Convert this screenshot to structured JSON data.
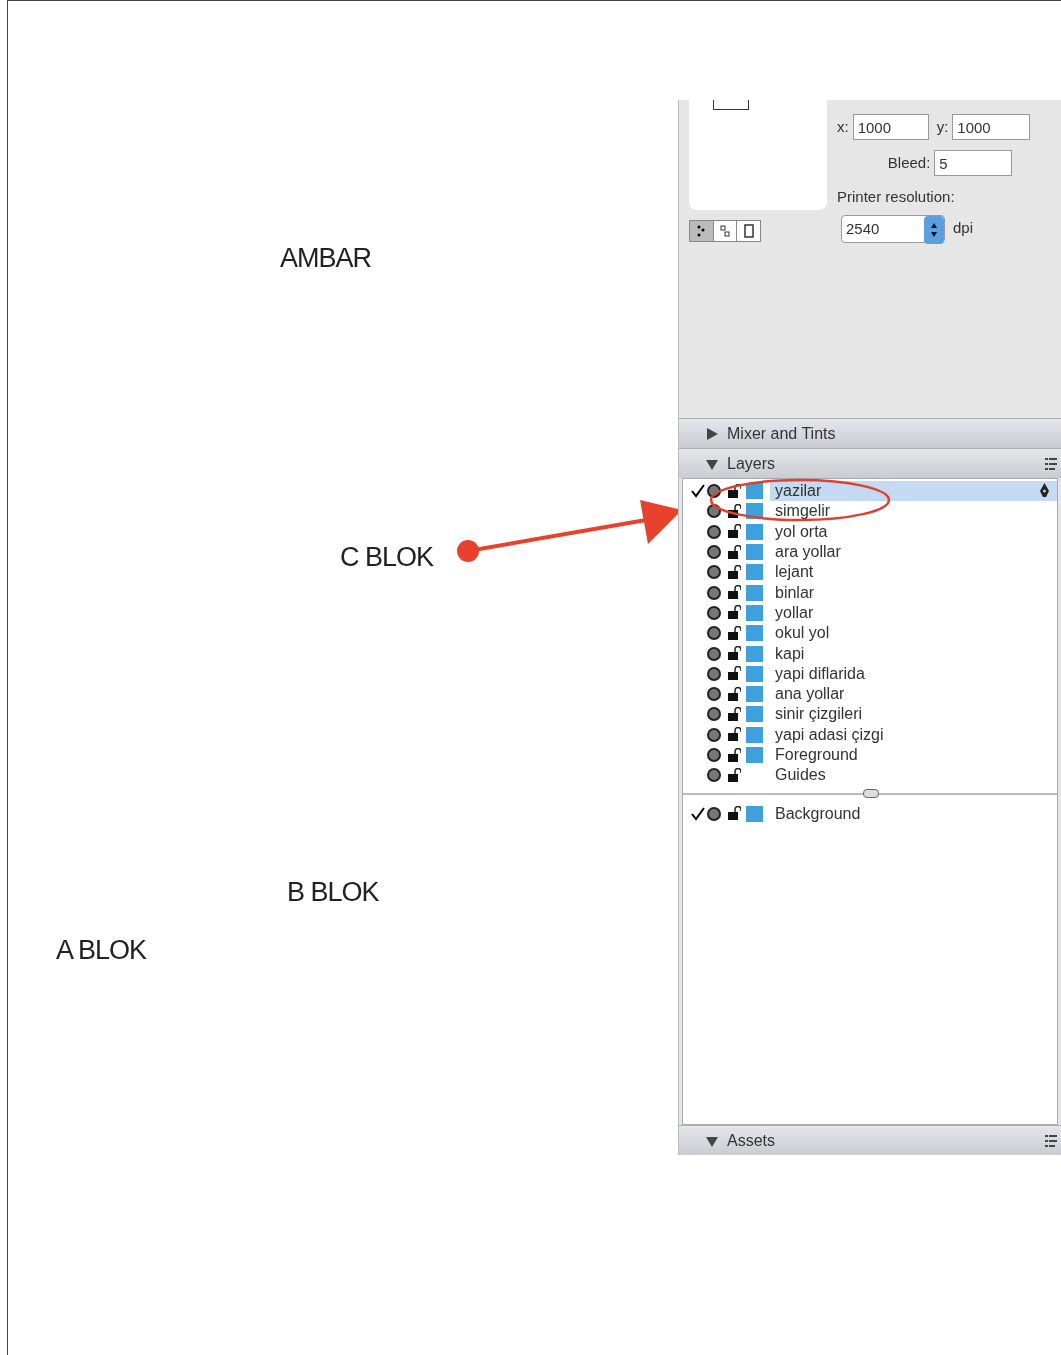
{
  "canvas_labels": [
    {
      "text": "AMBAR",
      "kind": "plain"
    },
    {
      "text": "C BLOK",
      "kind": "pointed"
    },
    {
      "text": "B BLOK",
      "kind": "plain"
    },
    {
      "text": "A BLOK",
      "kind": "plain"
    }
  ],
  "document": {
    "x_label": "x:",
    "x_value": "1000",
    "y_label": "y:",
    "y_value": "1000",
    "bleed_label": "Bleed:",
    "bleed_value": "5",
    "resolution_label": "Printer resolution:",
    "resolution_value": "2540",
    "resolution_unit": "dpi"
  },
  "mixer": {
    "title": "Mixer and Tints",
    "expanded": false
  },
  "layers": {
    "title": "Layers",
    "expanded": true,
    "items": [
      {
        "name": "yazilar",
        "checked": true,
        "swatch": true,
        "selected": true
      },
      {
        "name": "simgelir",
        "checked": false,
        "swatch": true,
        "selected": false
      },
      {
        "name": "yol orta",
        "checked": false,
        "swatch": true,
        "selected": false
      },
      {
        "name": "ara yollar",
        "checked": false,
        "swatch": true,
        "selected": false
      },
      {
        "name": "lejant",
        "checked": false,
        "swatch": true,
        "selected": false
      },
      {
        "name": "binlar",
        "checked": false,
        "swatch": true,
        "selected": false
      },
      {
        "name": "yollar",
        "checked": false,
        "swatch": true,
        "selected": false
      },
      {
        "name": "okul yol",
        "checked": false,
        "swatch": true,
        "selected": false
      },
      {
        "name": "kapi",
        "checked": false,
        "swatch": true,
        "selected": false
      },
      {
        "name": "yapi diflarida",
        "checked": false,
        "swatch": true,
        "selected": false
      },
      {
        "name": "ana yollar",
        "checked": false,
        "swatch": true,
        "selected": false
      },
      {
        "name": "sinir çizgileri",
        "checked": false,
        "swatch": true,
        "selected": false
      },
      {
        "name": "yapi adasi çizgi",
        "checked": false,
        "swatch": true,
        "selected": false
      },
      {
        "name": "Foreground",
        "checked": false,
        "swatch": true,
        "selected": false
      },
      {
        "name": "Guides",
        "checked": false,
        "swatch": false,
        "selected": false
      }
    ],
    "background_items": [
      {
        "name": "Background",
        "checked": true,
        "swatch": true,
        "selected": false
      }
    ]
  },
  "assets": {
    "title": "Assets",
    "expanded": true
  }
}
